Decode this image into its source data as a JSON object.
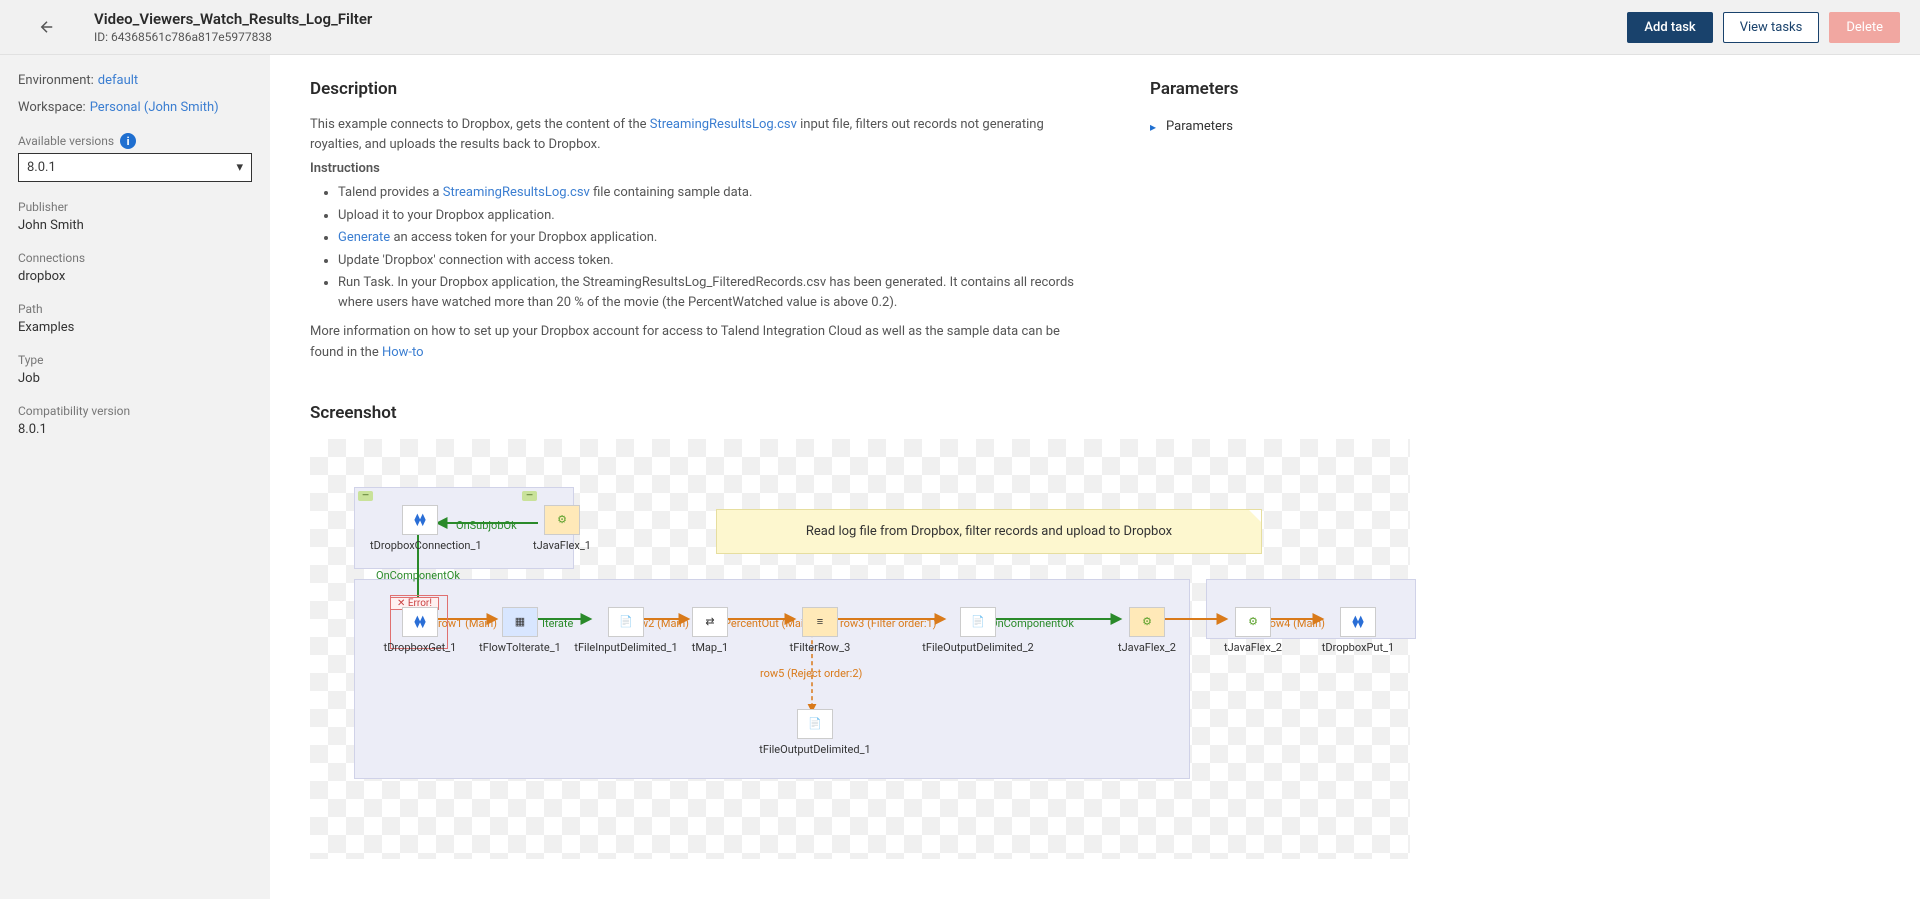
{
  "header": {
    "title": "Video_Viewers_Watch_Results_Log_Filter",
    "id_prefix": "ID:",
    "id": "64368561c786a817e5977838",
    "add_task": "Add task",
    "view_tasks": "View tasks",
    "delete": "Delete"
  },
  "sidebar": {
    "env_label": "Environment:",
    "env_value": "default",
    "workspace_label": "Workspace:",
    "workspace_value": "Personal (John Smith)",
    "versions_label": "Available versions",
    "version_selected": "8.0.1",
    "publisher_label": "Publisher",
    "publisher_value": "John Smith",
    "connections_label": "Connections",
    "connections_value": "dropbox",
    "path_label": "Path",
    "path_value": "Examples",
    "type_label": "Type",
    "type_value": "Job",
    "compat_label": "Compatibility version",
    "compat_value": "8.0.1"
  },
  "main": {
    "desc_label": "Description",
    "params_label": "Parameters",
    "params_item": "Parameters",
    "desc_pre": "This example connects to Dropbox, gets the content of the ",
    "desc_link1": "StreamingResultsLog.csv",
    "desc_post": " input file, filters out records not generating royalties, and uploads the results back to Dropbox.",
    "instructions_label": "Instructions",
    "inst1_pre": "Talend provides a ",
    "inst1_link": "StreamingResultsLog.csv",
    "inst1_post": " file containing sample data.",
    "inst2": "Upload it to your Dropbox application.",
    "inst3_link": "Generate",
    "inst3_post": " an access token for your Dropbox application.",
    "inst4": "Update 'Dropbox' connection with access token.",
    "inst5": "Run Task. In your Dropbox application, the StreamingResultsLog_FilteredRecords.csv has been generated. It contains all records where users have watched more than 20 % of the movie (the PercentWatched value is above 0.2).",
    "more_pre": "More information on how to set up your Dropbox account for access to Talend Integration Cloud as well as the sample data can be found in the ",
    "howto_link": "How-to",
    "screenshot_label": "Screenshot"
  },
  "diagram": {
    "note": "Read log file from Dropbox, filter records and upload to Dropbox",
    "on_subjob_ok": "OnSubjobOk",
    "on_component_ok": "OnComponentOk",
    "on_component_ok2": "OnComponentOk",
    "row1": "row1 (Main)",
    "iterate": "Iterate",
    "row2": "row2 (Main)",
    "percent_out": "PercentOut (Main)",
    "row3": "row3 (Filter order:1)",
    "row4": "row4 (Main)",
    "row5": "row5 (Reject order:2)",
    "error_tag": "✕ Error!",
    "c_dropbox_conn": "tDropboxConnection_1",
    "c_javaflex1": "tJavaFlex_1",
    "c_dropbox_get": "tDropboxGet_1",
    "c_flowtoiter": "tFlowToIterate_1",
    "c_fileinput": "tFileInputDelimited_1",
    "c_tmap": "tMap_1",
    "c_filterrow": "tFilterRow_3",
    "c_fileout2": "tFileOutputDelimited_2",
    "c_javaflex2": "tJavaFlex_2",
    "c_dropbox_put": "tDropboxPut_1",
    "c_fileout1": "tFileOutputDelimited_1"
  }
}
